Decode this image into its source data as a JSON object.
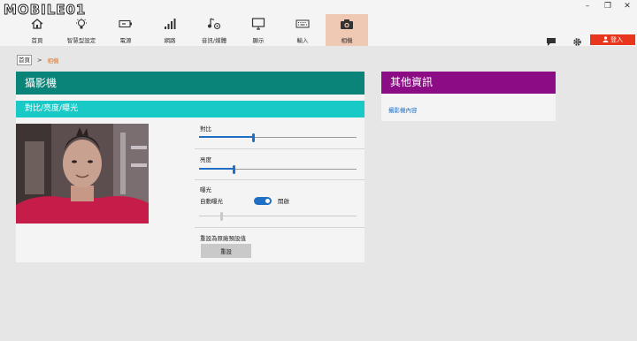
{
  "logo": {
    "text": "MOBILE01"
  },
  "window": {
    "minimize": "–",
    "restore": "❐",
    "close": "✕"
  },
  "nav": [
    {
      "label": "首頁",
      "icon": "home-icon"
    },
    {
      "label": "智慧型設定",
      "icon": "bulb-icon"
    },
    {
      "label": "電源",
      "icon": "battery-icon"
    },
    {
      "label": "網路",
      "icon": "network-icon"
    },
    {
      "label": "音訊/媒體",
      "icon": "music-icon"
    },
    {
      "label": "顯示",
      "icon": "monitor-icon"
    },
    {
      "label": "輸入",
      "icon": "keyboard-icon"
    },
    {
      "label": "相機",
      "icon": "camera-icon",
      "active": true
    }
  ],
  "toolbar": {
    "login_label": "登入"
  },
  "breadcrumb": {
    "home": "首頁",
    "sep": ">",
    "current": "相機"
  },
  "panel": {
    "title": "攝影機",
    "subtitle": "對比/亮度/曝光",
    "contrast": {
      "label": "對比",
      "value": 0.34
    },
    "brightness": {
      "label": "亮度",
      "value": 0.22
    },
    "exposure": {
      "label": "曝光",
      "auto_label": "自動曝光",
      "auto_state": "開啟",
      "value": 0.14
    },
    "reset": {
      "label": "重設為原廠預設值",
      "button": "重設"
    }
  },
  "side": {
    "title": "其他資訊",
    "link": "攝影機內容"
  },
  "colors": {
    "accent_blue": "#1f6fc4",
    "teal_header": "#0a8478",
    "cyan_sub": "#18c9c6",
    "purple_header": "#8c0c86",
    "login_red": "#e8361e",
    "active_tab": "#f0c9b4"
  }
}
